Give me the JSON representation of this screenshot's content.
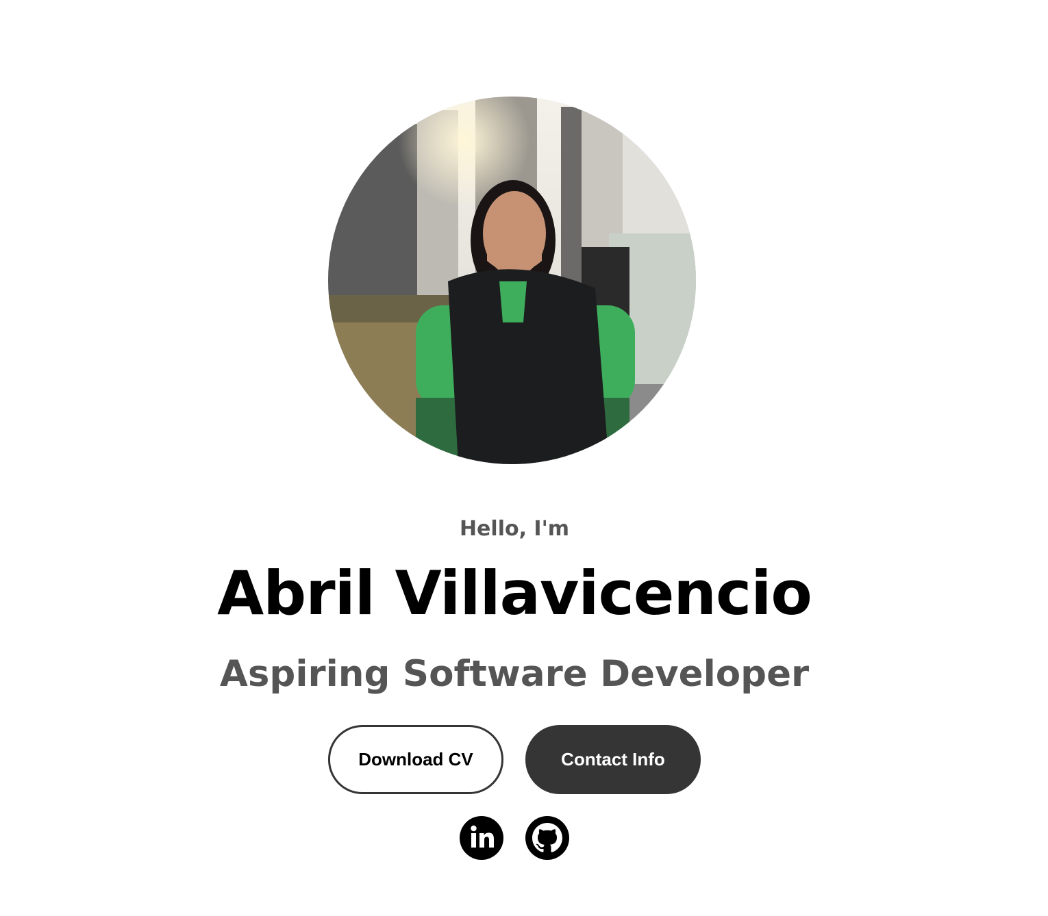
{
  "profile": {
    "greeting": "Hello, I'm",
    "name": "Abril Villavicencio",
    "role": "Aspiring Software Developer",
    "photo_alt": "Profile picture"
  },
  "actions": {
    "download_cv_label": "Download CV",
    "contact_info_label": "Contact Info"
  },
  "social": [
    {
      "icon": "linkedin-icon"
    },
    {
      "icon": "github-icon"
    }
  ],
  "colors": {
    "background": "#ffffff",
    "name_text": "#000000",
    "secondary_text": "#555555",
    "dark_button": "#353535",
    "dark_button_text": "#ffffff"
  }
}
